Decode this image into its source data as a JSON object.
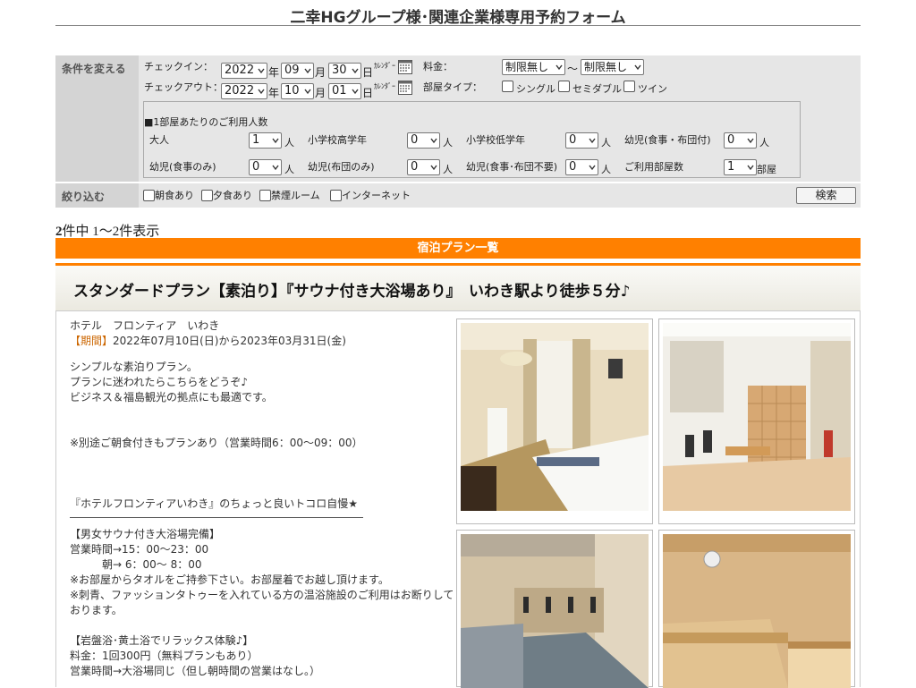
{
  "header": {
    "title": "二幸HGグループ様･関連企業様専用予約フォーム"
  },
  "form": {
    "cond_label": "条件を変える",
    "narrow_label": "絞り込む",
    "checkin_label": "チェックイン：",
    "checkout_label": "チェックアウト：",
    "checkin": {
      "year": "2022",
      "month": "09",
      "day": "30"
    },
    "checkout": {
      "year": "2022",
      "month": "10",
      "day": "01"
    },
    "unit_year": "年",
    "unit_month": "月",
    "unit_day": "日",
    "calendar_label": "ｶﾚﾝﾀﾞｰ",
    "price_label": "料金：",
    "price_min": "制限無し",
    "price_max": "制限無し",
    "price_sep": "～",
    "room_type_label": "部屋タイプ：",
    "room_types": [
      "シングル",
      "セミダブル",
      "ツイン"
    ],
    "people_heading": "■1部屋あたりのご利用人数",
    "person_unit": "人",
    "room_unit": "部屋",
    "guests": [
      {
        "label": "大人",
        "value": "1"
      },
      {
        "label": "小学校高学年",
        "value": "0"
      },
      {
        "label": "小学校低学年",
        "value": "0"
      },
      {
        "label": "幼児(食事・布団付)",
        "value": "0"
      },
      {
        "label": "幼児(食事のみ)",
        "value": "0"
      },
      {
        "label": "幼児(布団のみ)",
        "value": "0"
      },
      {
        "label": "幼児(食事･布団不要)",
        "value": "0"
      }
    ],
    "rooms_label": "ご利用部屋数",
    "rooms_value": "1",
    "filters": [
      "朝食あり",
      "夕食あり",
      "禁煙ルーム",
      "インターネット"
    ],
    "search_button": "検索"
  },
  "results": {
    "total": "2",
    "summary": "件中 1～2件表示"
  },
  "plan_list_title": "宿泊プラン一覧",
  "plan": {
    "title": "スタンダードプラン【素泊り】『サウナ付き大浴場あり』　いわき駅より徒歩５分♪",
    "hotel": "ホテル　フロンティア　いわき",
    "period_label": "【期間】",
    "period": "2022年07月10日(日)から2023年03月31日(金)",
    "desc": [
      "シンプルな素泊りプラン。",
      "プランに迷われたらこちらをどうぞ♪",
      "ビジネス＆福島観光の拠点にも最適です。",
      "※別途ご朝食付きもプランあり（営業時間6：00～09：00）",
      "『ホテルフロンティアいわき』のちょっと良いトコロ自慢★",
      "【男女サウナ付き大浴場完備】",
      "営業時間→15：00～23：00",
      "　　　朝→ 6：00～ 8：00",
      "※お部屋からタオルをご持参下さい。お部屋着でお越し頂けます。",
      "※刺青、ファッションタトゥーを入れている方の温浴施設のご利用はお断りして",
      "おります。",
      "【岩盤浴･黄土浴でリラックス体験♪】",
      "料金：1回300円（無料プランもあり）",
      "営業時間→大浴場同じ（但し朝時間の営業はなし。）"
    ]
  },
  "colors": {
    "accent": "#ff8000",
    "form_bg": "#e6e6e6",
    "label_bg": "#d4d4d4",
    "period": "#cc6600"
  }
}
